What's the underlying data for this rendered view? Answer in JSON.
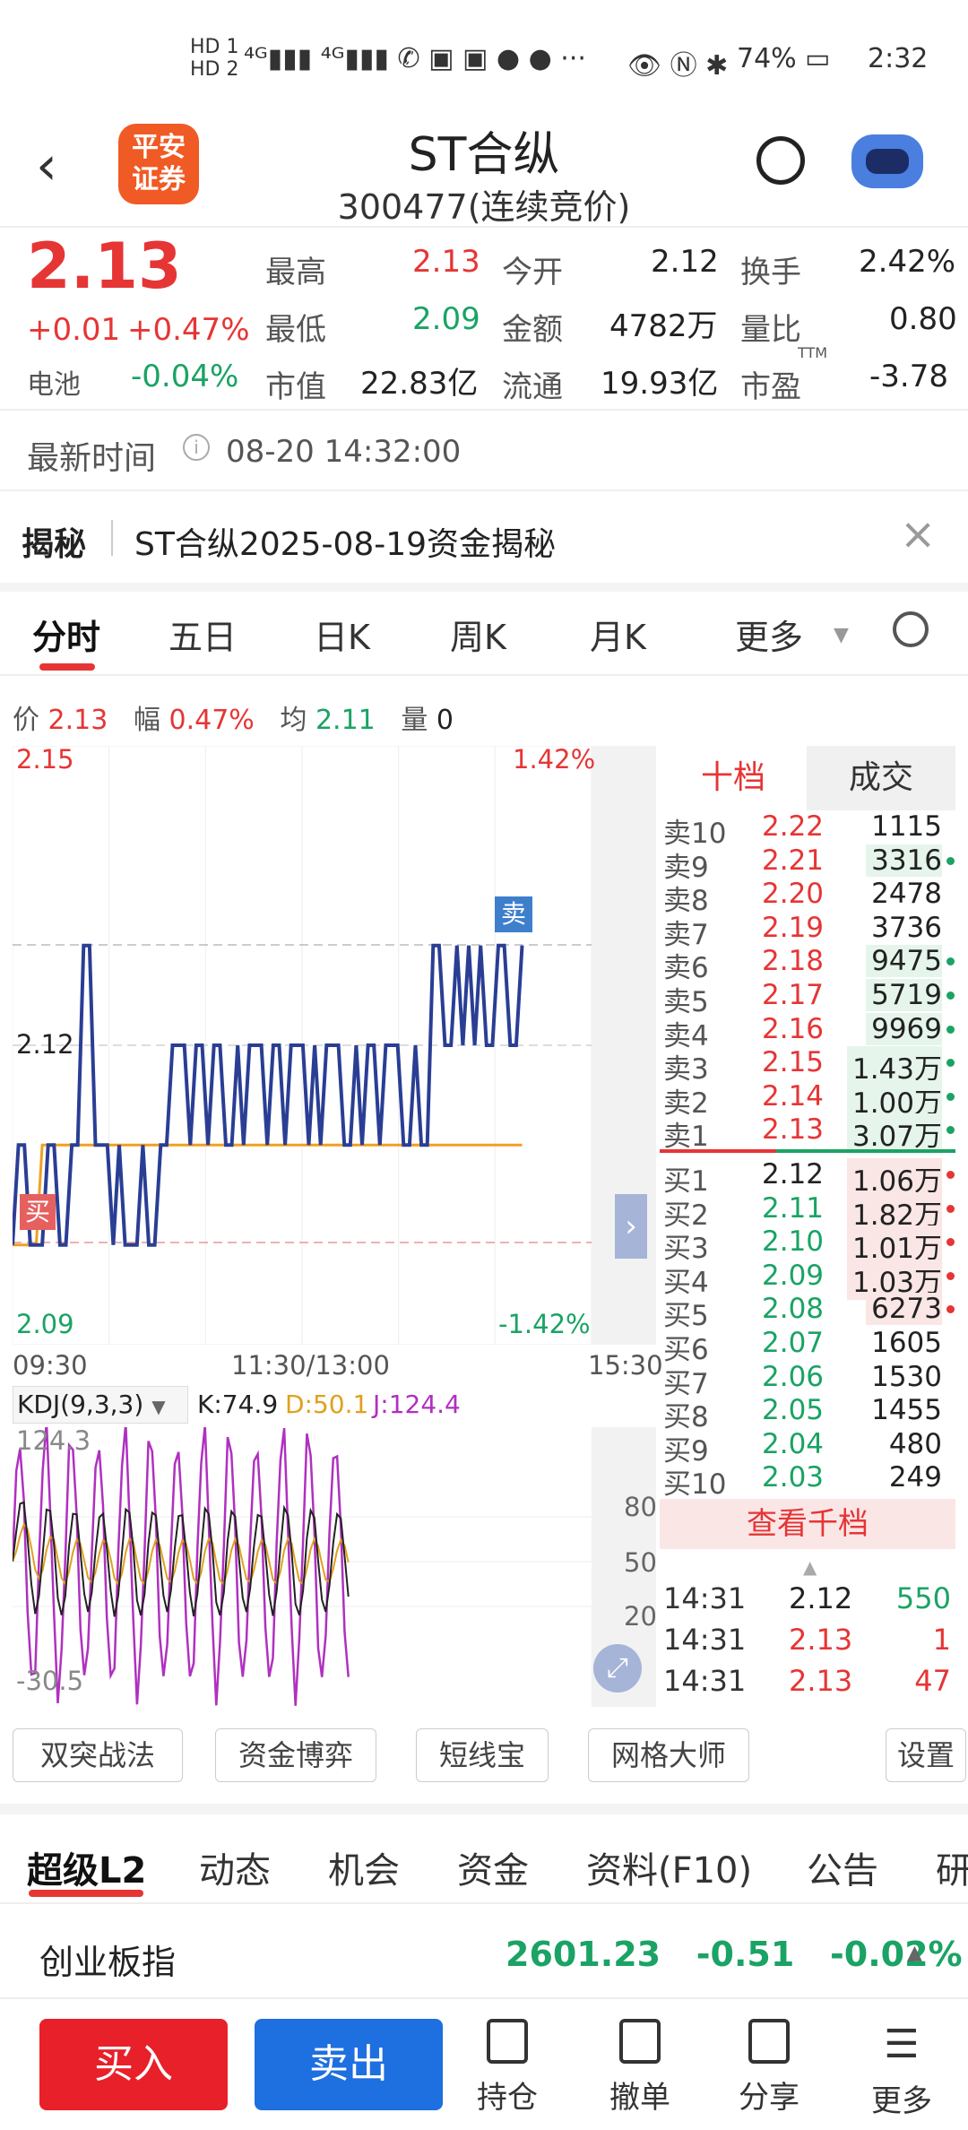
{
  "status": {
    "time": "2:32",
    "battery": "74%"
  },
  "header": {
    "name": "ST合纵",
    "code": "300477",
    "status": "(连续竞价)",
    "logo_line1": "平安",
    "logo_line2": "证券"
  },
  "quote": {
    "price": "2.13",
    "change": "+0.01",
    "change_pct": "+0.47%",
    "battery_label": "电池",
    "battery_pct": "-0.04%",
    "high_label": "最高",
    "high": "2.13",
    "open_label": "今开",
    "open": "2.12",
    "turnover_label": "换手",
    "turnover": "2.42%",
    "low_label": "最低",
    "low": "2.09",
    "amount_label": "金额",
    "amount": "4782万",
    "vol_ratio_label": "量比",
    "vol_ratio": "0.80",
    "mcap_label": "市值",
    "mcap": "22.83亿",
    "float_label": "流通",
    "float": "19.93亿",
    "pe_label": "市盈",
    "pe_sup": "TTM",
    "pe": "-3.78"
  },
  "update": {
    "label": "最新时间",
    "time": "08-20 14:32:00"
  },
  "reveal": {
    "label": "揭秘",
    "text": "ST合纵2025-08-19资金揭秘"
  },
  "tabs": [
    "分时",
    "五日",
    "日K",
    "周K",
    "月K",
    "更多"
  ],
  "info_line": {
    "price_label": "价",
    "price": "2.13",
    "amp_label": "幅",
    "amp": "0.47%",
    "avg_label": "均",
    "avg": "2.11",
    "vol_label": "量",
    "vol": "0"
  },
  "chart_data": {
    "type": "line",
    "title": "",
    "y_top": "2.15",
    "y_mid": "2.12",
    "y_bottom": "2.09",
    "pct_top": "1.42%",
    "pct_bottom": "-1.42%",
    "x_start": "09:30",
    "x_mid": "11:30/13:00",
    "x_end": "15:30",
    "ylim": [
      2.09,
      2.15
    ],
    "buy_marker": "买",
    "sell_marker": "卖",
    "series": [
      {
        "name": "",
        "values": [
          2.1,
          2.11,
          2.11,
          2.1,
          2.1,
          2.1,
          2.11,
          2.11,
          2.1,
          2.1,
          2.11,
          2.11,
          2.13,
          2.13,
          2.11,
          2.11,
          2.11,
          2.1,
          2.11,
          2.1,
          2.1,
          2.1,
          2.11,
          2.1,
          2.1,
          2.11,
          2.11,
          2.12,
          2.12,
          2.12,
          2.11,
          2.12,
          2.12,
          2.11,
          2.12,
          2.12,
          2.11,
          2.11,
          2.12,
          2.11,
          2.12,
          2.12,
          2.12,
          2.11,
          2.12,
          2.12,
          2.11,
          2.12,
          2.12,
          2.12,
          2.11,
          2.12,
          2.11,
          2.12,
          2.12,
          2.12,
          2.11,
          2.11,
          2.12,
          2.11,
          2.12,
          2.12,
          2.11,
          2.12,
          2.12,
          2.12,
          2.11,
          2.11,
          2.12,
          2.11,
          2.11,
          2.13,
          2.13,
          2.12,
          2.12,
          2.13,
          2.12,
          2.13,
          2.12,
          2.13,
          2.12,
          2.12,
          2.13,
          2.13,
          2.12,
          2.12,
          2.13
        ]
      },
      {
        "name": "",
        "values": [
          2.1,
          2.1,
          2.1,
          2.1,
          2.1,
          2.11,
          2.11,
          2.11,
          2.11,
          2.11,
          2.11,
          2.11,
          2.11,
          2.11,
          2.11,
          2.11,
          2.11,
          2.11,
          2.11,
          2.11,
          2.11,
          2.11,
          2.11,
          2.11,
          2.11,
          2.11,
          2.11,
          2.11,
          2.11,
          2.11,
          2.11,
          2.11,
          2.11,
          2.11,
          2.11,
          2.11,
          2.11,
          2.11,
          2.11,
          2.11,
          2.11,
          2.11,
          2.11,
          2.11,
          2.11,
          2.11,
          2.11,
          2.11,
          2.11,
          2.11,
          2.11,
          2.11,
          2.11,
          2.11,
          2.11,
          2.11,
          2.11,
          2.11,
          2.11,
          2.11,
          2.11,
          2.11,
          2.11,
          2.11,
          2.11,
          2.11,
          2.11,
          2.11,
          2.11,
          2.11,
          2.11,
          2.11,
          2.11,
          2.11,
          2.11,
          2.11,
          2.11,
          2.11,
          2.11,
          2.11,
          2.11,
          2.11,
          2.11,
          2.11,
          2.11,
          2.11,
          2.11
        ]
      }
    ],
    "kdj": {
      "label": "KDJ(9,3,3)",
      "k": "K:74.9",
      "d": "D:50.1",
      "j": "J:124.4",
      "top": "124.3",
      "bottom": "-30.5",
      "lvl80": "80",
      "lvl50": "50",
      "lvl20": "20"
    }
  },
  "orderbook": {
    "tab_ten": "十档",
    "tab_trades": "成交",
    "asks": [
      {
        "label": "卖10",
        "price": "2.22",
        "vol": "1115",
        "dot": ""
      },
      {
        "label": "卖9",
        "price": "2.21",
        "vol": "3316",
        "dot": "g"
      },
      {
        "label": "卖8",
        "price": "2.20",
        "vol": "2478",
        "dot": ""
      },
      {
        "label": "卖7",
        "price": "2.19",
        "vol": "3736",
        "dot": ""
      },
      {
        "label": "卖6",
        "price": "2.18",
        "vol": "9475",
        "dot": "g"
      },
      {
        "label": "卖5",
        "price": "2.17",
        "vol": "5719",
        "dot": "g"
      },
      {
        "label": "卖4",
        "price": "2.16",
        "vol": "9969",
        "dot": "g"
      },
      {
        "label": "卖3",
        "price": "2.15",
        "vol": "1.43万",
        "dot": "g"
      },
      {
        "label": "卖2",
        "price": "2.14",
        "vol": "1.00万",
        "dot": "g"
      },
      {
        "label": "卖1",
        "price": "2.13",
        "vol": "3.07万",
        "dot": "g"
      }
    ],
    "bids": [
      {
        "label": "买1",
        "price": "2.12",
        "vol": "1.06万",
        "dot": "r"
      },
      {
        "label": "买2",
        "price": "2.11",
        "vol": "1.82万",
        "dot": "r"
      },
      {
        "label": "买3",
        "price": "2.10",
        "vol": "1.01万",
        "dot": "r"
      },
      {
        "label": "买4",
        "price": "2.09",
        "vol": "1.03万",
        "dot": "r"
      },
      {
        "label": "买5",
        "price": "2.08",
        "vol": "6273",
        "dot": "r"
      },
      {
        "label": "买6",
        "price": "2.07",
        "vol": "1605",
        "dot": ""
      },
      {
        "label": "买7",
        "price": "2.06",
        "vol": "1530",
        "dot": ""
      },
      {
        "label": "买8",
        "price": "2.05",
        "vol": "1455",
        "dot": ""
      },
      {
        "label": "买9",
        "price": "2.04",
        "vol": "480",
        "dot": ""
      },
      {
        "label": "买10",
        "price": "2.03",
        "vol": "249",
        "dot": ""
      }
    ],
    "view_thousand": "查看千档",
    "trades": [
      {
        "time": "14:31",
        "price": "2.12",
        "vol": "550"
      },
      {
        "time": "14:31",
        "price": "2.13",
        "vol": "1"
      },
      {
        "time": "14:31",
        "price": "2.13",
        "vol": "47"
      }
    ]
  },
  "tools": [
    "双突战法",
    "资金博弈",
    "短线宝",
    "网格大师",
    "设置"
  ],
  "subtabs": [
    "超级L2",
    "动态",
    "机会",
    "资金",
    "资料(F10)",
    "公告",
    "研"
  ],
  "index": {
    "name": "创业板指",
    "value": "2601.23",
    "change": "-0.51",
    "pct": "-0.02%"
  },
  "bottom": {
    "buy": "买入",
    "sell": "卖出",
    "hold": "持仓",
    "cancel": "撤单",
    "share": "分享",
    "more": "更多"
  }
}
